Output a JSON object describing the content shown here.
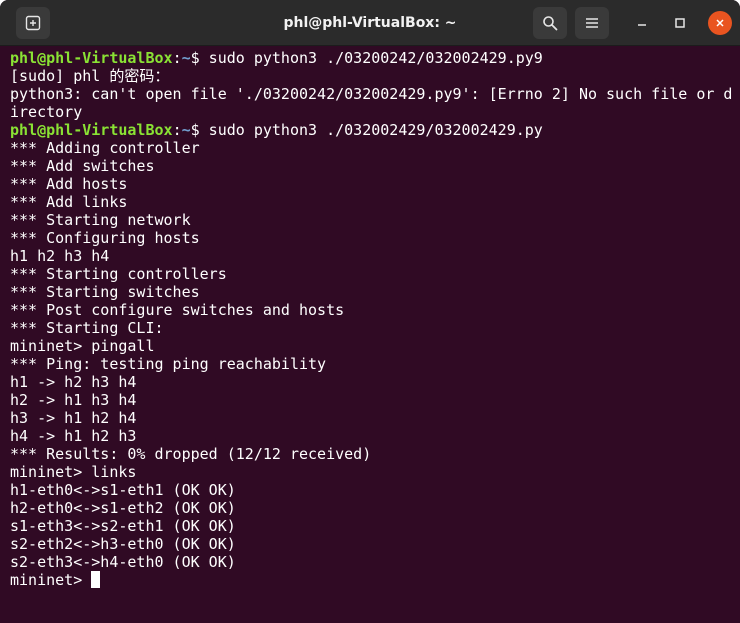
{
  "window": {
    "title": "phl@phl-VirtualBox: ~"
  },
  "icons": {
    "new_tab": "new-tab-icon",
    "search": "search-icon",
    "menu": "hamburger-menu-icon",
    "minimize": "minimize-icon",
    "maximize": "maximize-icon",
    "close": "close-icon"
  },
  "colors": {
    "terminal_bg": "#300a24",
    "prompt_user": "#8ae234",
    "prompt_path": "#729fcf",
    "close_button": "#e95420"
  },
  "terminal": {
    "cmd1": {
      "user": "phl@phl-VirtualBox",
      "sep": ":",
      "path": "~",
      "command": "$ sudo python3 ./03200242/032002429.py9"
    },
    "out1": [
      "[sudo] phl 的密码：",
      "python3: can't open file './03200242/032002429.py9': [Errno 2] No such file or d",
      "irectory"
    ],
    "cmd2": {
      "user": "phl@phl-VirtualBox",
      "sep": ":",
      "path": "~",
      "command": "$ sudo python3 ./032002429/032002429.py"
    },
    "out2": [
      "*** Adding controller",
      "*** Add switches",
      "*** Add hosts",
      "*** Add links",
      "*** Starting network",
      "*** Configuring hosts",
      "h1 h2 h3 h4",
      "*** Starting controllers",
      "*** Starting switches",
      "*** Post configure switches and hosts",
      "*** Starting CLI:",
      "mininet> pingall",
      "*** Ping: testing ping reachability",
      "h1 -> h2 h3 h4",
      "h2 -> h1 h3 h4",
      "h3 -> h1 h2 h4",
      "h4 -> h1 h2 h3",
      "*** Results: 0% dropped (12/12 received)",
      "mininet> links",
      "h1-eth0<->s1-eth1 (OK OK)",
      "h2-eth0<->s1-eth2 (OK OK)",
      "s1-eth3<->s2-eth1 (OK OK)",
      "s2-eth2<->h3-eth0 (OK OK)",
      "s2-eth3<->h4-eth0 (OK OK)"
    ],
    "final_prompt": "mininet> "
  }
}
